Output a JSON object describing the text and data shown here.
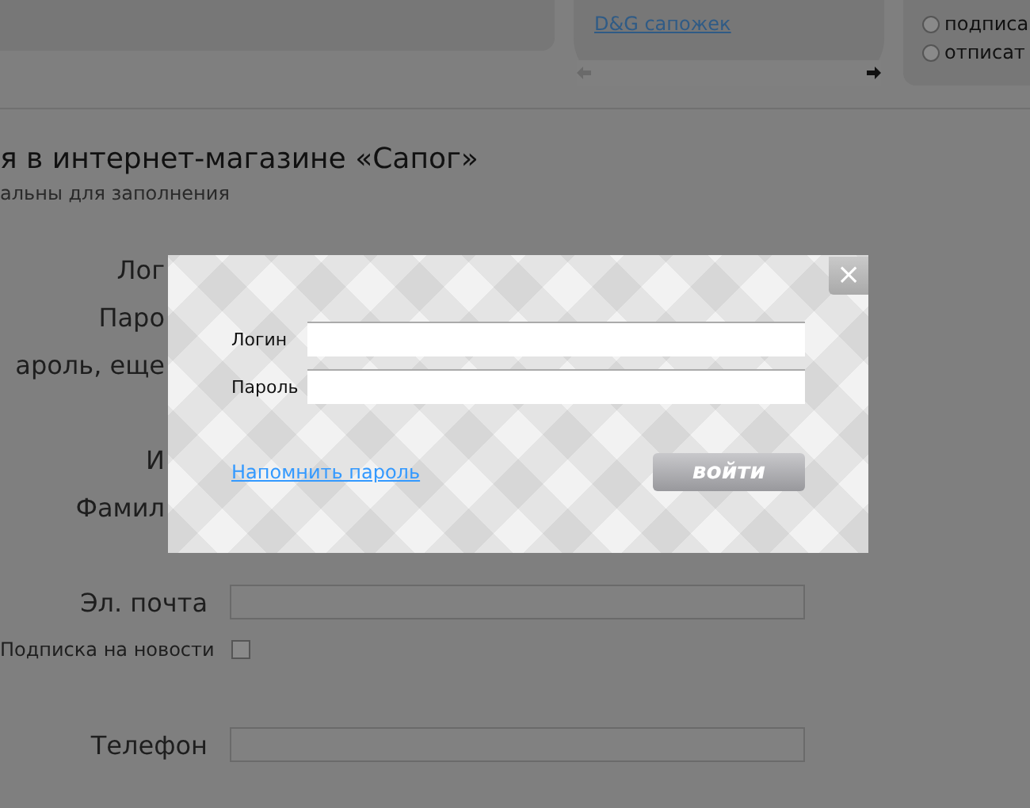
{
  "news_panel": {
    "link": "D&G сапожек"
  },
  "subscribe_panel": {
    "options": [
      {
        "label": "подписа",
        "selected": false
      },
      {
        "label": "отписат",
        "selected": false
      }
    ]
  },
  "heading": "я в интернет-магазине «Сапог»",
  "subheading": "альны для заполнения",
  "form_rows": [
    {
      "kind": "cut",
      "label": "Лог"
    },
    {
      "kind": "cut",
      "label": "Паро"
    },
    {
      "kind": "cut",
      "label": "ароль, еще"
    },
    {
      "kind": "gap"
    },
    {
      "kind": "cut",
      "label": "И"
    },
    {
      "kind": "cut",
      "label": "Фамил"
    },
    {
      "kind": "gap"
    },
    {
      "kind": "field",
      "label": "Эл. почта"
    },
    {
      "kind": "checkbox",
      "label": "Подписка на новости",
      "checked": false
    },
    {
      "kind": "gap"
    },
    {
      "kind": "field",
      "label": "Телефон"
    }
  ],
  "login_dialog": {
    "close": "×",
    "fields": [
      {
        "label": "Логин"
      },
      {
        "label": "Пароль"
      }
    ],
    "remind_link": "Напомнить пароль",
    "submit": "войти"
  }
}
